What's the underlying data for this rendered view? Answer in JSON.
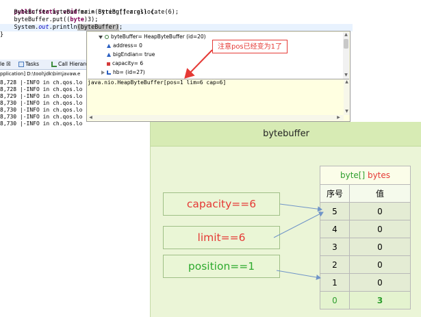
{
  "editor": {
    "line1": {
      "kw1": "public",
      "kw2": "static",
      "kw3": "void",
      "rest": "main(String[] args) {"
    },
    "line2": "    ByteBuffer byteBuffer = ByteBuffer.allocate(6);",
    "line3": {
      "pre": "    byteBuffer.put((",
      "kw": "byte",
      "post": ")3);"
    },
    "line4": {
      "pre": "    System.",
      "field": "out",
      "mid": ".println",
      "sel": "(byteBuffer)",
      "post": ";"
    },
    "line5": "}"
  },
  "left_panel": {
    "tabs": [
      "le ☒",
      "Tasks",
      "Call Hierarc"
    ],
    "console_title": "pplication] D:\\tool\\jdk\\bin\\javaw.e",
    "log_lines": [
      "8,728 |-INFO in ch.qos.lo",
      "8,728 |-INFO in ch.qos.lo",
      "8,729 |-INFO in ch.qos.lo",
      "8,730 |-INFO in ch.qos.lo",
      "8,730 |-INFO in ch.qos.lo",
      "8,730 |-INFO in ch.qos.lo",
      "8,730 |-INFO in ch.qos.lo"
    ]
  },
  "popup": {
    "root": "byteBuffer= HeapByteBuffer  (id=20)",
    "fields": [
      "address= 0",
      "bigEndian= true",
      "capacity= 6",
      "hb= (id=27)"
    ],
    "detail": "java.nio.HeapByteBuffer[pos=1 lim=6 cap=6]"
  },
  "annotation": {
    "text": "注意pos已经变为1了",
    "color": "#e53935"
  },
  "diagram": {
    "title": "bytebuffer",
    "boxes": [
      {
        "label": "capacity==6",
        "color": "#e53935"
      },
      {
        "label": "limit==6",
        "color": "#e53935"
      },
      {
        "label": "position==1",
        "color": "#2eaa2e"
      }
    ],
    "table": {
      "caption_left": "byte[] ",
      "caption_right": "bytes",
      "col_index": "序号",
      "col_value": "值",
      "rows": [
        {
          "index": "5",
          "value": "0"
        },
        {
          "index": "4",
          "value": "0"
        },
        {
          "index": "3",
          "value": "0"
        },
        {
          "index": "2",
          "value": "0"
        },
        {
          "index": "1",
          "value": "0"
        },
        {
          "index": "0",
          "value": "3"
        }
      ]
    }
  }
}
